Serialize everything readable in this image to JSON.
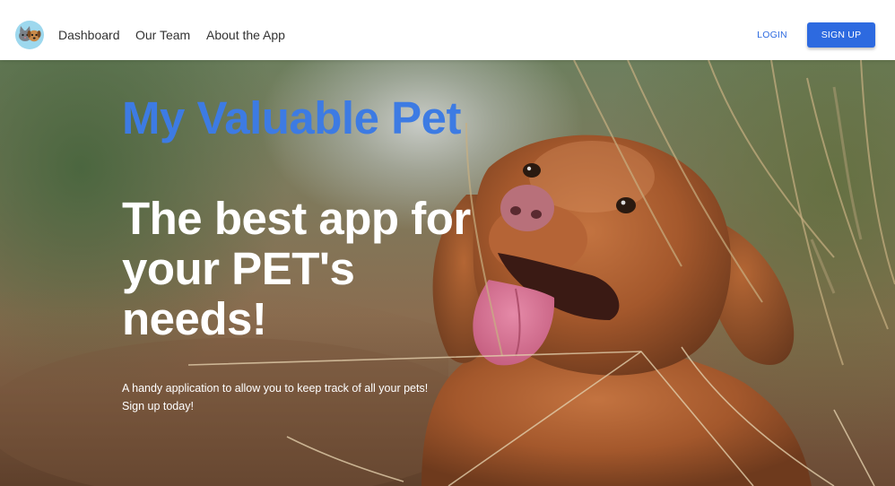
{
  "navbar": {
    "logo_icon": "pet-logo-icon",
    "links": [
      {
        "label": "Dashboard"
      },
      {
        "label": "Our Team"
      },
      {
        "label": "About the App"
      }
    ],
    "login_label": "LOGIN",
    "signup_label": "SIGN UP"
  },
  "hero": {
    "title": "My Valuable Pet",
    "heading": "The best app for your PET's needs!",
    "description_line1": "A handy application to allow you to keep track of all your pets!",
    "description_line2": "Sign up today!",
    "background_image": "dog-photo"
  },
  "colors": {
    "accent": "#2d6ae0",
    "title_blue": "#3d7be3",
    "navbar_bg": "#ffffff",
    "logo_bg": "#9dd8ee"
  }
}
